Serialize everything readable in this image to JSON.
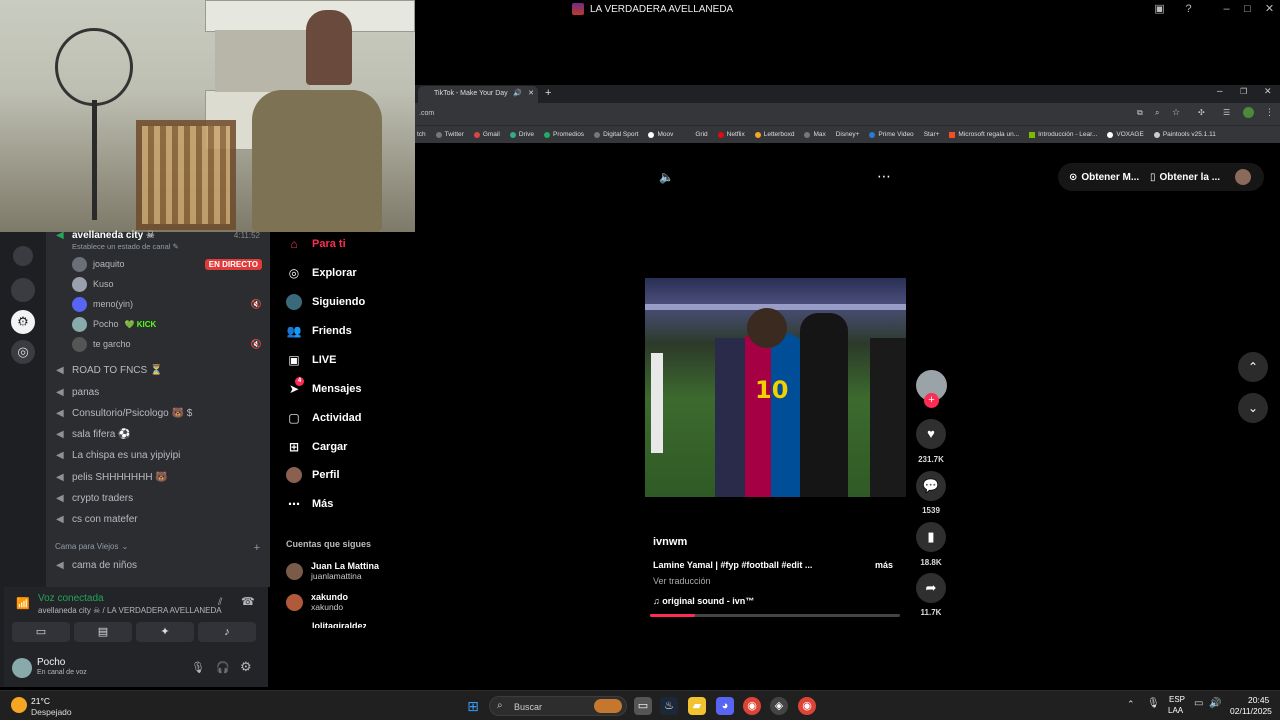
{
  "window": {
    "title": "LA VERDADERA AVELLANEDA"
  },
  "discord": {
    "channel_name": "avellaneda city ☠",
    "channel_status": "Establece un estado de canal ✎",
    "channel_time": "4:11:52",
    "members": [
      {
        "name": "joaquito",
        "badge": "EN DIRECTO"
      },
      {
        "name": "Kuso"
      },
      {
        "name": "meno(yin)"
      },
      {
        "name": "Pocho",
        "tag": "💚 KICK"
      },
      {
        "name": "te garcho"
      }
    ],
    "channels": [
      "ROAD TO FNCS ⏳",
      "panas",
      "Consultorio/Psicologo 🐻 $",
      "sala fifera ⚽",
      "La chispa es una yipiyipi",
      "pelis SHHHHHHH 🐻",
      "crypto traders",
      "cs con matefer"
    ],
    "category": "Cama para Viejos",
    "category_channels": [
      "cama de niños"
    ],
    "voice": {
      "status": "Voz conectada",
      "channel": "avellaneda city ☠ / LA VERDADERA AVELLANEDA"
    },
    "user": {
      "name": "Pocho",
      "status": "En canal de voz"
    }
  },
  "browser": {
    "tab_title": "TikTok - Make Your Day",
    "url": ".com",
    "bookmarks": [
      "tch",
      "Twitter",
      "Gmail",
      "Drive",
      "Promedios",
      "Digital Sport",
      "Moov",
      "Grid",
      "Netflix",
      "Letterboxd",
      "Max",
      "Disney+",
      "Prime Video",
      "Star+",
      "Microsoft regala un...",
      "Introducción - Lear...",
      "VOXAGE",
      "Paintools v25.1.11"
    ]
  },
  "tiktok": {
    "nav": [
      {
        "label": "Para ti",
        "icon": "home-icon"
      },
      {
        "label": "Explorar",
        "icon": "compass-icon"
      },
      {
        "label": "Siguiendo",
        "icon": "following-avatar-icon"
      },
      {
        "label": "Friends",
        "icon": "friends-icon"
      },
      {
        "label": "LIVE",
        "icon": "live-icon"
      },
      {
        "label": "Mensajes",
        "icon": "send-icon",
        "badge": "4"
      },
      {
        "label": "Actividad",
        "icon": "inbox-icon"
      },
      {
        "label": "Cargar",
        "icon": "upload-icon"
      },
      {
        "label": "Perfil",
        "icon": "profile-avatar-icon"
      },
      {
        "label": "Más",
        "icon": "more-dots-icon"
      }
    ],
    "following_header": "Cuentas que sigues",
    "following": [
      {
        "name": "Juan La Mattina",
        "user": "juanlamattina"
      },
      {
        "name": "xakundo",
        "user": "xakundo"
      },
      {
        "name": "",
        "user": "lolitagiraldez"
      }
    ],
    "top_buttons": [
      "Obtener M...",
      "Obtener la ..."
    ],
    "video": {
      "author": "ivnwm",
      "description": "Lamine Yamal | #fyp #football #edit ...",
      "more": "más",
      "translate": "Ver traducción",
      "sound": "♫  original sound - ivn™",
      "likes": "231.7K",
      "comments": "1539",
      "saves": "18.8K",
      "shares": "11.7K",
      "progress": 0.18
    }
  },
  "taskbar": {
    "weather_temp": "21°C",
    "weather_desc": "Despejado",
    "search_placeholder": "Buscar",
    "lang1": "ESP",
    "lang2": "LAA",
    "time": "20:45",
    "date": "02/11/2025"
  }
}
